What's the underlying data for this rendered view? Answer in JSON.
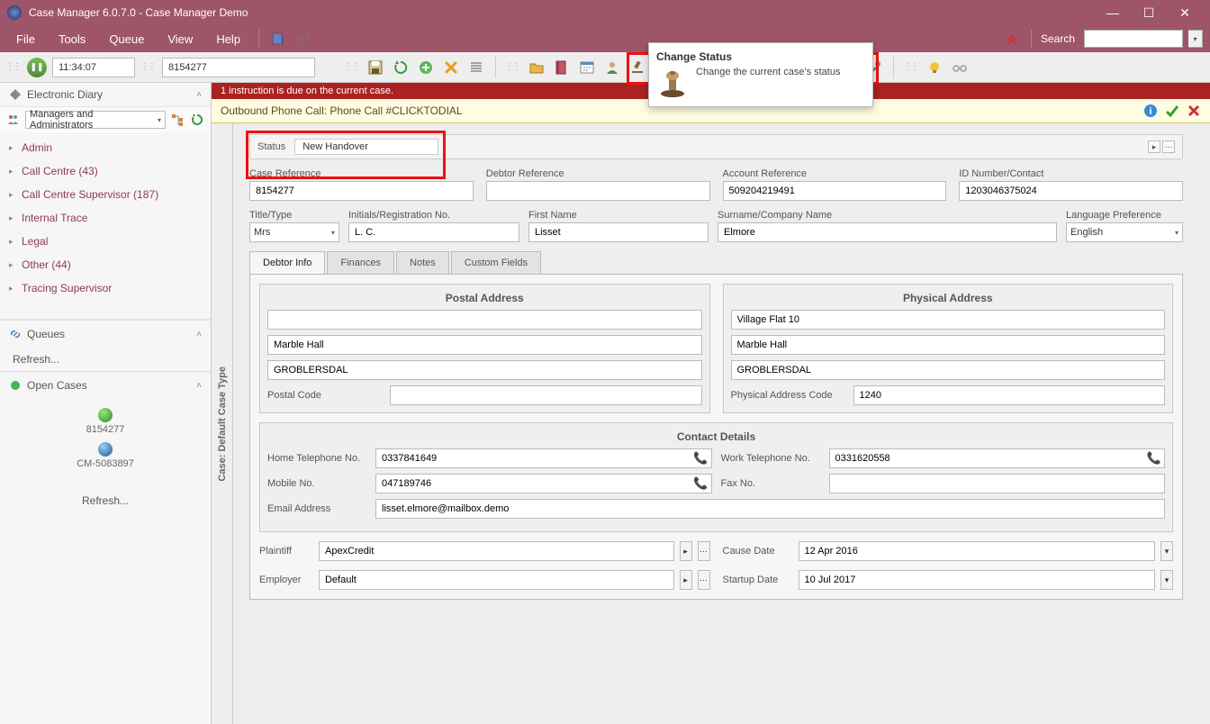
{
  "titlebar": {
    "text": "Case Manager 6.0.7.0 - Case Manager Demo"
  },
  "menu": {
    "file": "File",
    "tools": "Tools",
    "queue": "Queue",
    "view": "View",
    "help": "Help",
    "search_label": "Search"
  },
  "toolbar": {
    "time": "11:34:07",
    "queue_id": "8154277"
  },
  "sidebar": {
    "diary": "Electronic Diary",
    "role_combo": "Managers and Administrators",
    "tree": {
      "admin": "Admin",
      "callcentre": "Call Centre (43)",
      "ccsupervisor": "Call Centre Supervisor (187)",
      "itrace": "Internal Trace",
      "legal": "Legal",
      "other": "Other (44)",
      "tsupervisor": "Tracing Supervisor"
    },
    "queues": "Queues",
    "refresh": "Refresh...",
    "open_cases": "Open Cases",
    "case1": "8154277",
    "case2": "CM-5083897"
  },
  "content": {
    "alert": "1 instruction is due on the current case.",
    "callbar": "Outbound Phone Call: Phone Call #CLICKTODIAL",
    "vbar": "Case: Default Case Type",
    "status": {
      "label": "Status",
      "value": "New Handover"
    },
    "labels": {
      "case_ref": "Case Reference",
      "debtor_ref": "Debtor Reference",
      "acct_ref": "Account Reference",
      "idnum": "ID Number/Contact",
      "title": "Title/Type",
      "initials": "Initials/Registration No.",
      "fname": "First Name",
      "surname": "Surname/Company Name",
      "lang": "Language Preference"
    },
    "vals": {
      "case_ref": "8154277",
      "debtor_ref": "",
      "acct_ref": "509204219491",
      "idnum": "1203046375024",
      "title": "Mrs",
      "initials": "L. C.",
      "fname": "Lisset",
      "surname": "Elmore",
      "lang": "English"
    },
    "tabs": {
      "debtor": "Debtor Info",
      "finances": "Finances",
      "notes": "Notes",
      "custom": "Custom Fields"
    },
    "postal": {
      "title": "Postal Address",
      "l1": "",
      "l2": "Marble Hall",
      "l3": "GROBLERSDAL",
      "pc_label": "Postal Code",
      "pc": ""
    },
    "physical": {
      "title": "Physical Address",
      "l1": "Village Flat 10",
      "l2": "Marble Hall",
      "l3": "GROBLERSDAL",
      "pc_label": "Physical Address Code",
      "pc": "1240"
    },
    "contact": {
      "title": "Contact Details",
      "home_l": "Home Telephone No.",
      "home": "0337841649",
      "work_l": "Work Telephone No.",
      "work": "0331620558",
      "mobile_l": "Mobile No.",
      "mobile": "047189746",
      "fax_l": "Fax No.",
      "fax": "",
      "email_l": "Email Address",
      "email": "lisset.elmore@mailbox.demo"
    },
    "bottom": {
      "plaintiff_l": "Plaintiff",
      "plaintiff": "ApexCredit",
      "cause_l": "Cause Date",
      "cause": "12 Apr 2016",
      "employer_l": "Employer",
      "employer": "Default",
      "startup_l": "Startup Date",
      "startup": "10 Jul 2017"
    }
  },
  "tooltip": {
    "title": "Change Status",
    "desc": "Change the current case's status"
  }
}
